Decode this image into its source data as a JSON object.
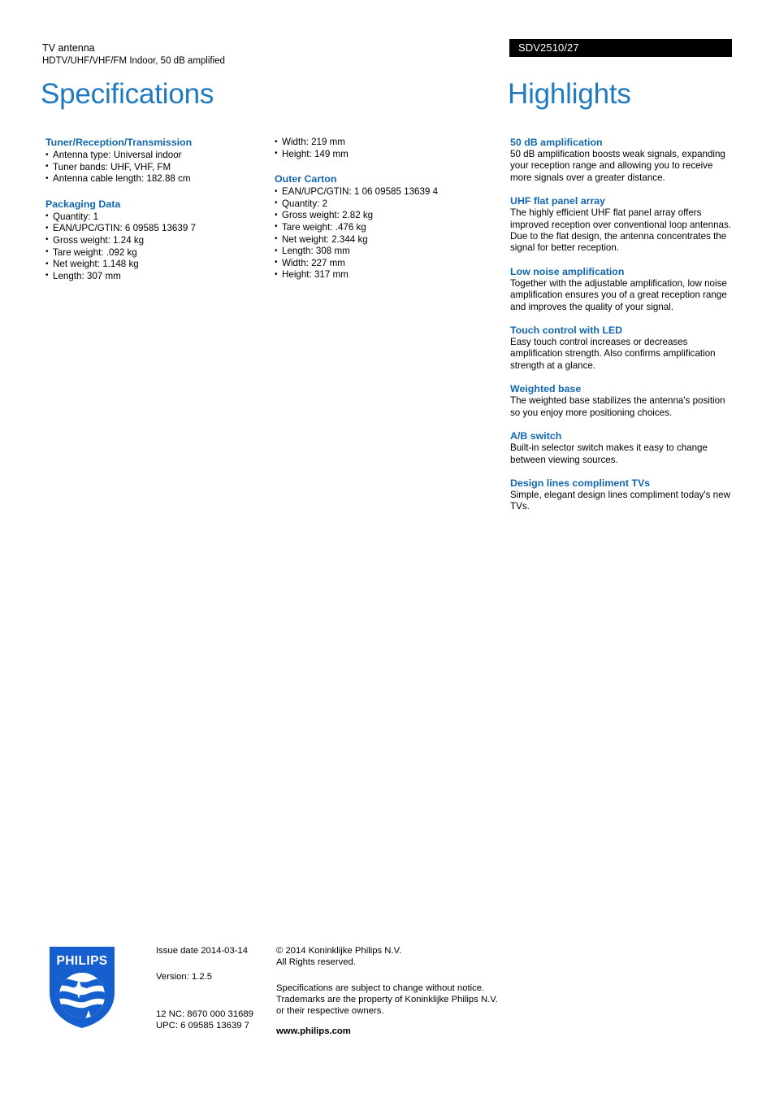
{
  "header": {
    "product_name": "TV antenna",
    "product_subtitle": "HDTV/UHF/VHF/FM Indoor, 50 dB amplified",
    "model_number": "SDV2510/27",
    "title_left": "Specifications",
    "title_right": "Highlights"
  },
  "colors": {
    "title_blue": "#1f7ac0",
    "heading_blue": "#1266b0",
    "model_bar_bg": "#000000",
    "logo_blue": "#1560CE"
  },
  "specifications": {
    "column_a": [
      {
        "heading": "Tuner/Reception/Transmission",
        "items": [
          "Antenna type: Universal indoor",
          "Tuner bands: UHF, VHF, FM",
          "Antenna cable length: 182.88 cm"
        ]
      },
      {
        "heading": "Packaging Data",
        "items": [
          "Quantity: 1",
          "EAN/UPC/GTIN: 6 09585 13639 7",
          "Gross weight: 1.24 kg",
          "Tare weight: .092 kg",
          "Net weight: 1.148 kg",
          "Length: 307 mm"
        ]
      }
    ],
    "column_b": [
      {
        "heading": "",
        "items": [
          "Width: 219 mm",
          "Height: 149 mm"
        ]
      },
      {
        "heading": "Outer Carton",
        "items": [
          "EAN/UPC/GTIN: 1 06 09585 13639 4",
          "Quantity: 2",
          "Gross weight: 2.82 kg",
          "Tare weight: .476 kg",
          "Net weight: 2.344 kg",
          "Length: 308 mm",
          "Width: 227 mm",
          "Height: 317 mm"
        ]
      }
    ]
  },
  "highlights": [
    {
      "title": "50 dB amplification",
      "body": "50 dB amplification boosts weak signals, expanding your reception range and allowing you to receive more signals over a greater distance."
    },
    {
      "title": "UHF flat panel array",
      "body": "The highly efficient UHF flat panel array offers improved reception over conventional loop antennas. Due to the flat design, the antenna concentrates the signal for better reception."
    },
    {
      "title": "Low noise amplification",
      "body": "Together with the adjustable amplification, low noise amplification ensures you of a great reception range and improves the quality of your signal."
    },
    {
      "title": "Touch control with LED",
      "body": "Easy touch control increases or decreases amplification strength. Also confirms amplification strength at a glance."
    },
    {
      "title": "Weighted base",
      "body": "The weighted base stabilizes the antenna's position so you enjoy more positioning choices."
    },
    {
      "title": "A/B switch",
      "body": "Built-in selector switch makes it easy to change between viewing sources."
    },
    {
      "title": "Design lines compliment TVs",
      "body": "Simple, elegant design lines compliment today's new TVs."
    }
  ],
  "footer": {
    "logo_wordmark": "PHILIPS",
    "issue_date": "Issue date 2014-03-14",
    "version": "Version: 1.2.5",
    "nc_code": "12 NC: 8670 000 31689",
    "upc_code": "UPC: 6 09585 13639 7",
    "copyright_line1": "© 2014 Koninklijke Philips N.V.",
    "copyright_line2": "All Rights reserved.",
    "disclaimer_line1": "Specifications are subject to change without notice.",
    "disclaimer_line2": "Trademarks are the property of Koninklijke Philips N.V.",
    "disclaimer_line3": "or their respective owners.",
    "website": "www.philips.com"
  }
}
